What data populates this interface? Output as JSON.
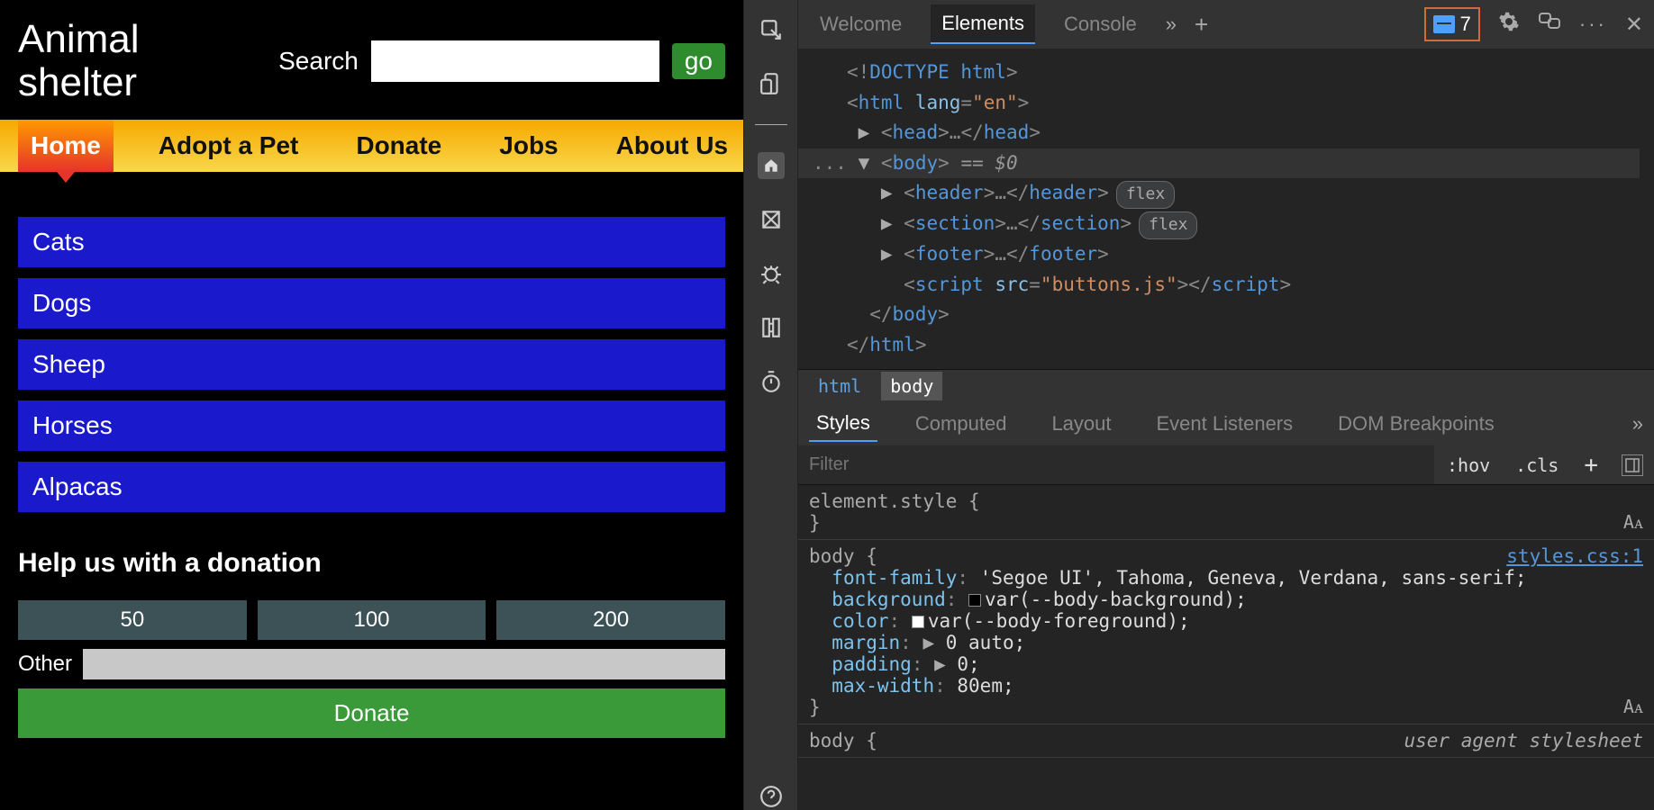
{
  "page": {
    "brand": "Animal shelter",
    "search_label": "Search",
    "search_placeholder": "",
    "go_label": "go",
    "nav": [
      "Home",
      "Adopt a Pet",
      "Donate",
      "Jobs",
      "About Us"
    ],
    "nav_active_index": 0,
    "animals": [
      "Cats",
      "Dogs",
      "Sheep",
      "Horses",
      "Alpacas"
    ],
    "donation": {
      "title": "Help us with a donation",
      "amounts": [
        "50",
        "100",
        "200"
      ],
      "other_label": "Other",
      "donate_label": "Donate"
    }
  },
  "devtools": {
    "tabs": [
      "Welcome",
      "Elements",
      "Console"
    ],
    "active_tab_index": 1,
    "more_tabs_glyph": "»",
    "new_tab_glyph": "+",
    "issues_count": "7",
    "dom": {
      "doctype": "<!DOCTYPE html>",
      "html_open": "<html lang=\"en\">",
      "head": "<head>…</head>",
      "ellipsis": "...",
      "body_open": "<body>",
      "body_marker": " == $0",
      "header": "<header>…</header>",
      "header_badge": "flex",
      "section": "<section>…</section>",
      "section_badge": "flex",
      "footer": "<footer>…</footer>",
      "script": "<script src=\"buttons.js\">…",
      "body_close": "</body>",
      "html_close": "</html>"
    },
    "crumbs": [
      "html",
      "body"
    ],
    "crumb_active_index": 1,
    "styles_tabs": [
      "Styles",
      "Computed",
      "Layout",
      "Event Listeners",
      "DOM Breakpoints"
    ],
    "styles_active_index": 0,
    "filter_placeholder": "Filter",
    "filter_buttons": {
      "hov": ":hov",
      "cls": ".cls",
      "plus": "+"
    },
    "rules": {
      "element_style": "element.style {",
      "element_style_close": "}",
      "body_selector": "body {",
      "body_link": "styles.css:1",
      "props": [
        {
          "name": "font-family",
          "value": "'Segoe UI', Tahoma, Geneva, Verdana, sans-serif;"
        },
        {
          "name": "background",
          "value": "var(--body-background);",
          "swatch": "#000"
        },
        {
          "name": "color",
          "value": "var(--body-foreground);",
          "swatch": "#fff"
        },
        {
          "name": "margin",
          "value": "0 auto;",
          "expand": true
        },
        {
          "name": "padding",
          "value": "0;",
          "expand": true
        },
        {
          "name": "max-width",
          "value": "80em;"
        }
      ],
      "body_close": "}",
      "uas_selector": "body {",
      "uas_label": "user agent stylesheet"
    }
  }
}
